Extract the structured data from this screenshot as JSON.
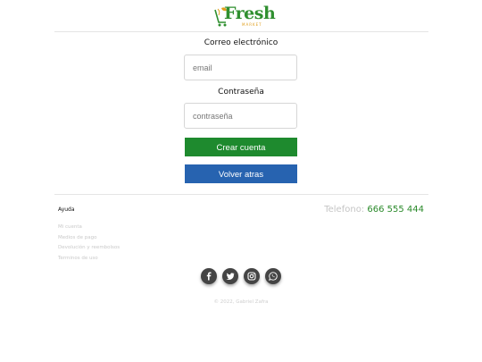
{
  "brand": {
    "name": "Fresh",
    "tagline": "MARKET",
    "accent": "#2f8f2f"
  },
  "form": {
    "email_label": "Correo electrónico",
    "email_placeholder": "email",
    "password_label": "Contraseña",
    "password_placeholder": "contraseña",
    "create_button": "Crear cuenta",
    "back_button": "Volver atras"
  },
  "footer": {
    "help_title": "Ayuda",
    "links": [
      "Mi cuenta",
      "Medios de pago",
      "Devolución y reembolsos",
      "Terminos de uso"
    ],
    "phone_label": "Telefono:",
    "phone_number": "666 555 444",
    "social_icons": [
      "facebook-icon",
      "twitter-icon",
      "instagram-icon",
      "whatsapp-icon"
    ],
    "copyright": "© 2022, Gabriel Zafra"
  },
  "colors": {
    "green_button": "#1e8a2e",
    "blue_button": "#2763b0"
  }
}
